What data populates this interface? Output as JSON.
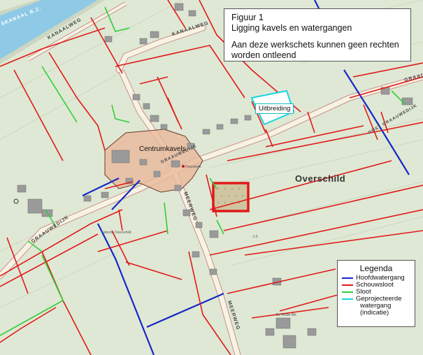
{
  "caption": {
    "line1": "Figuur 1",
    "line2": "Ligging kavels en watergangen",
    "line3": "Aan deze werkschets kunnen geen rechten",
    "line4": "worden ontleend"
  },
  "labels": {
    "uitbreiding": "Uitbreiding",
    "centrumkavels": "Centrumkavels",
    "place": "Overschild",
    "kanaal": "SKANAAL B.Z.",
    "kanaalweg": "KANAALWEG",
    "kanaalweg2": "KANAALWEG",
    "graauwedijk_right": "GRAAU",
    "graauwedijk_mid": "GRAAUWEDIJK",
    "graauwedijk_left": "GRAAUWEDIJK",
    "graauwedijk_east": "OOST GRAAUWEDIJK",
    "meerweg": "MEERWEG",
    "meerweg2": "MEERWEG",
    "school": "Lisboon Overschild",
    "church": "Dorpskerk",
    "farm": "De Wilde Rik",
    "spot": "-1.5"
  },
  "legend": {
    "title": "Legenda",
    "items": [
      {
        "label": "Hoofdwatergang",
        "color": "#1428c8"
      },
      {
        "label": "Schouwsloot",
        "color": "#e01a1a"
      },
      {
        "label": "Sloot",
        "color": "#2fcf3a"
      },
      {
        "label": "Geprojecteerde",
        "label2": "watergang",
        "label3": "(indicatie)",
        "color": "#16d6e0"
      }
    ]
  },
  "colors": {
    "hoofdwatergang": "#1428c8",
    "schouwsloot": "#e01a1a",
    "sloot": "#2fcf3a",
    "geprojecteerd": "#16d6e0",
    "centrum_fill": "#e8b89a",
    "field": "#dfe8d4",
    "road": "#f7f3e2"
  }
}
